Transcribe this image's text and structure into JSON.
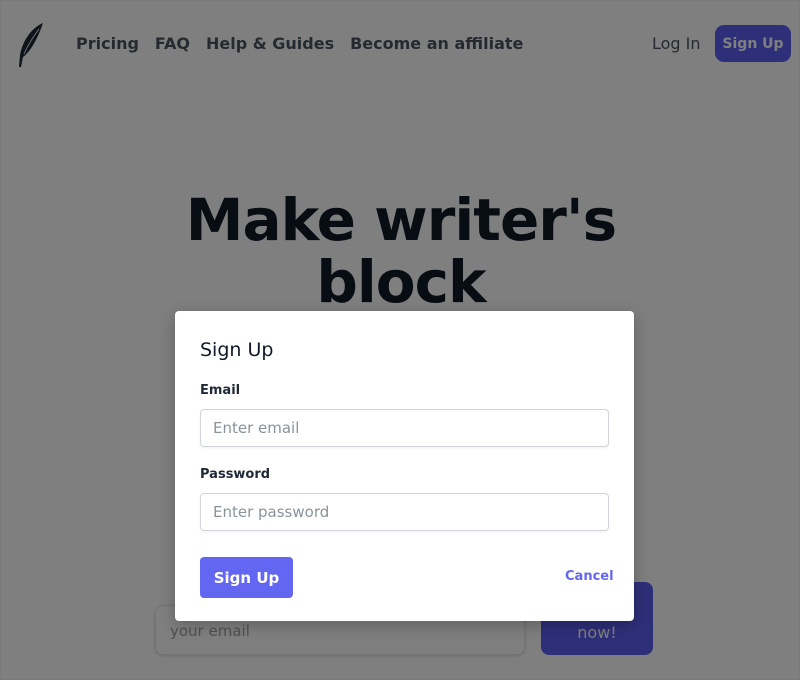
{
  "header": {
    "nav": [
      "Pricing",
      "FAQ",
      "Help & Guides",
      "Become an affiliate"
    ],
    "login_label": "Log In",
    "signup_label": "Sign Up",
    "logo_icon": "feather-icon"
  },
  "hero": {
    "title_line1": "Make writer's",
    "title_line2": "block",
    "email_placeholder": "your email",
    "cta_label": "now!"
  },
  "modal": {
    "title": "Sign Up",
    "email_label": "Email",
    "email_placeholder": "Enter email",
    "password_label": "Password",
    "password_placeholder": "Enter password",
    "submit_label": "Sign Up",
    "cancel_label": "Cancel"
  },
  "colors": {
    "accent": "#6366f1",
    "header_button": "#5d5ff2",
    "overlay": "#000000"
  }
}
